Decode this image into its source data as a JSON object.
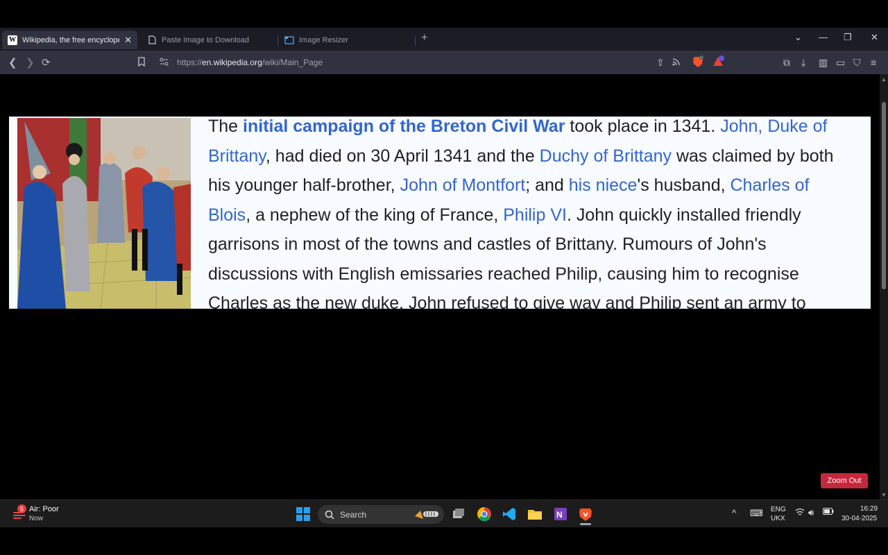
{
  "tabs": [
    {
      "title": "Wikipedia, the free encyclopedia",
      "favicon": "W"
    },
    {
      "title": "Paste Image to Download"
    },
    {
      "title": "Image Resizer"
    }
  ],
  "address": {
    "scheme": "https://",
    "host": "en.wikipedia.org",
    "path": "/wiki/Main_Page"
  },
  "article": {
    "l1_a": "The ",
    "l1_link_bold": "initial campaign of the Breton Civil War",
    "l1_b": " took place in 1341. ",
    "l1_link": "John, Duke of",
    "l2_link": "Brittany",
    "l2_a": ", had died on 30 April 1341 and the ",
    "l2_link2": "Duchy of Brittany",
    "l2_b": " was claimed by both",
    "l3_a": "his younger half-brother, ",
    "l3_link": "John of Montfort",
    "l3_b": "; and ",
    "l3_link2": "his niece",
    "l3_c": "'s husband, ",
    "l3_link3": "Charles of",
    "l4_link": "Blois",
    "l4_a": ", a nephew of the king of France, ",
    "l4_link2": "Philip VI",
    "l4_b": ". John quickly installed friendly",
    "l5": "garrisons in most of the towns and castles of Brittany. Rumours of John's",
    "l6": "discussions with English emissaries reached Philip, causing him to recognise",
    "l7": "Charles as the new duke. John refused to give way and Philip sent an army to"
  },
  "zoom_button": "Zoom Out",
  "taskbar": {
    "weather_badge": "5",
    "weather_label": "Air: Poor",
    "weather_time": "Now",
    "search_label": "Search",
    "lang_top": "ENG",
    "lang_bottom": "UKX",
    "time": "16:29",
    "date": "30-04-2025"
  },
  "colors": {
    "link": "#3366cc",
    "zoom": "#c5283d",
    "tab_active": "#30323f"
  }
}
